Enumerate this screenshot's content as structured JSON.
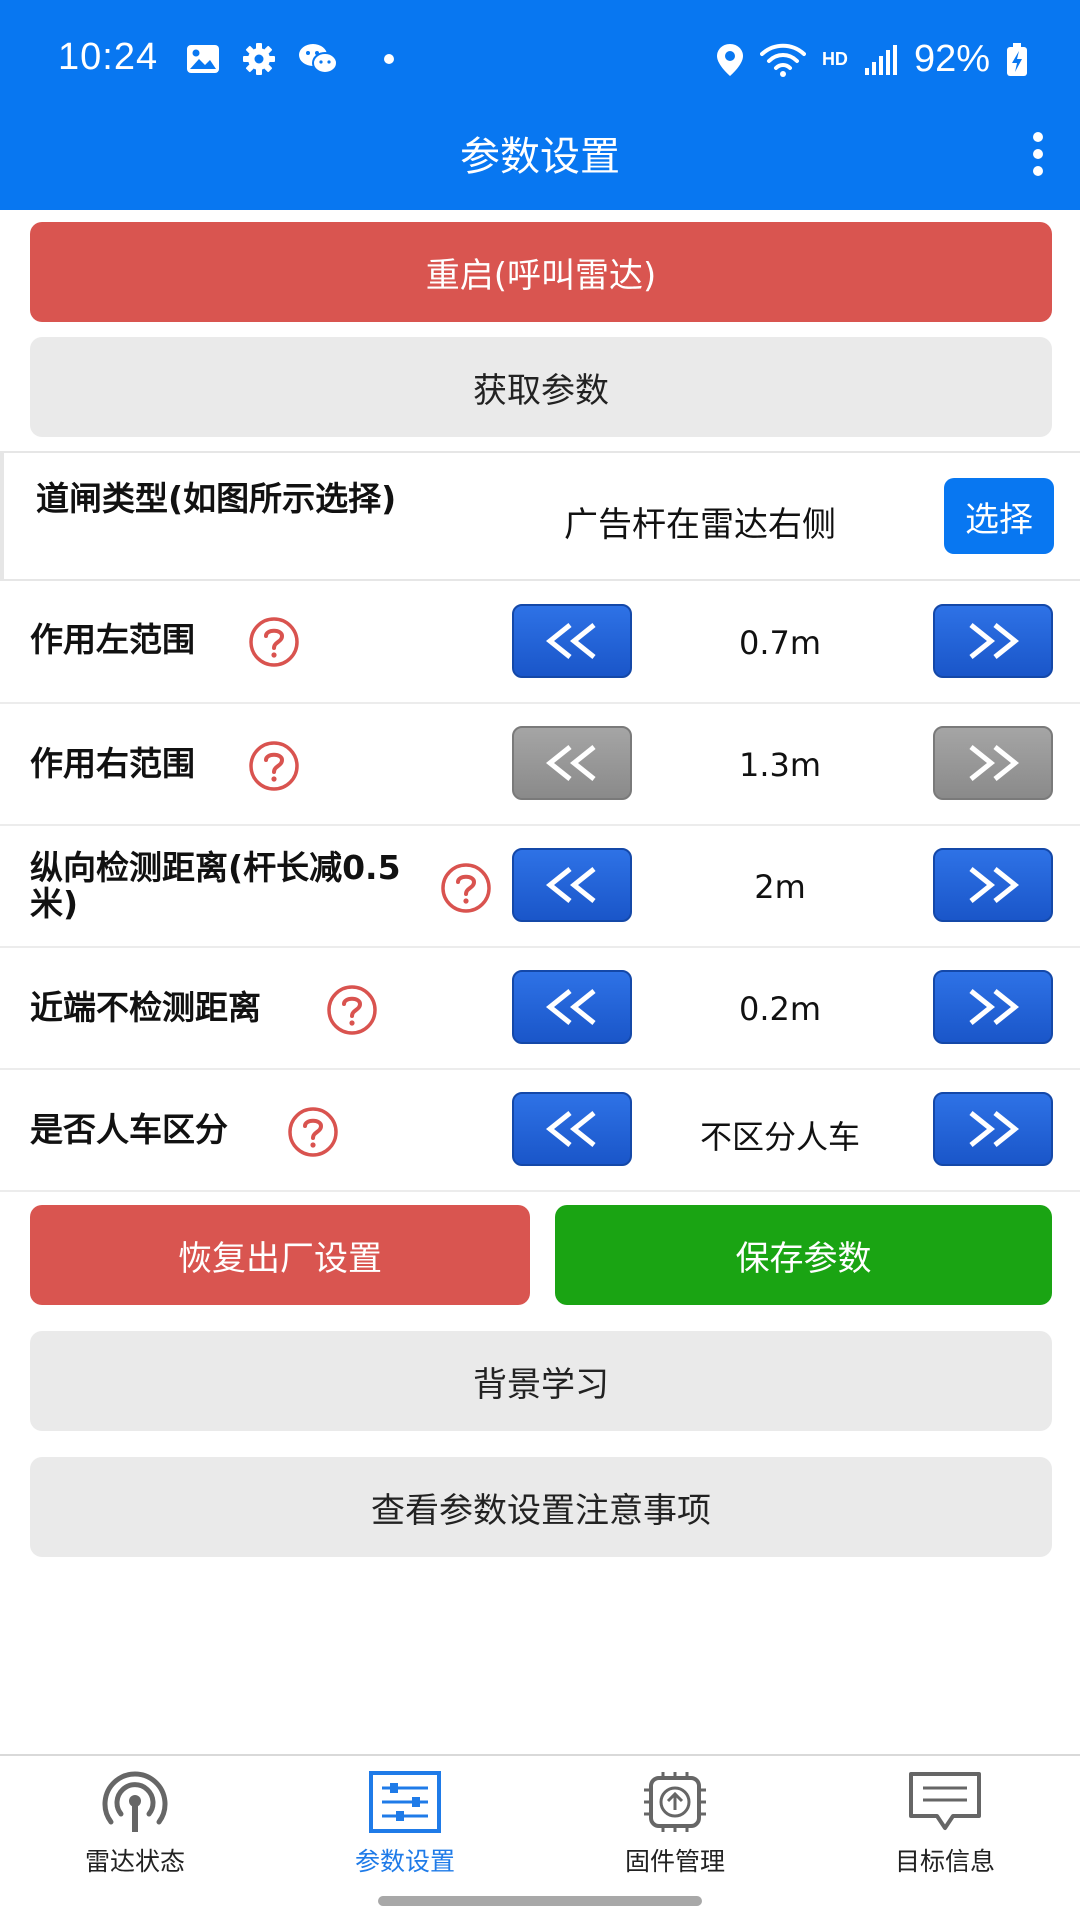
{
  "status_bar": {
    "time": "10:24",
    "network": "HD",
    "battery": "92%"
  },
  "header": {
    "title": "参数设置"
  },
  "buttons": {
    "restart": "重启(呼叫雷达)",
    "get_params": "获取参数",
    "factory_reset": "恢复出厂设置",
    "save": "保存参数",
    "bg_learning": "背景学习",
    "view_notes": "查看参数设置注意事项"
  },
  "gate": {
    "label": "道闸类型(如图所示选择)",
    "value": "广告杆在雷达右侧",
    "select_label": "选择"
  },
  "params": [
    {
      "label": "作用左范围",
      "value": "0.7m"
    },
    {
      "label": "作用右范围",
      "value": "1.3m"
    },
    {
      "label": "纵向检测距离(杆长减0.5米)",
      "value": "2m"
    },
    {
      "label": "近端不检测距离",
      "value": "0.2m"
    },
    {
      "label": "是否人车区分",
      "value": "不区分人车"
    }
  ],
  "nav": [
    {
      "label": "雷达状态"
    },
    {
      "label": "参数设置"
    },
    {
      "label": "固件管理"
    },
    {
      "label": "目标信息"
    }
  ],
  "colors": {
    "primary": "#0877f1",
    "danger": "#d95550",
    "success": "#1aa413",
    "help": "#d9534f"
  }
}
